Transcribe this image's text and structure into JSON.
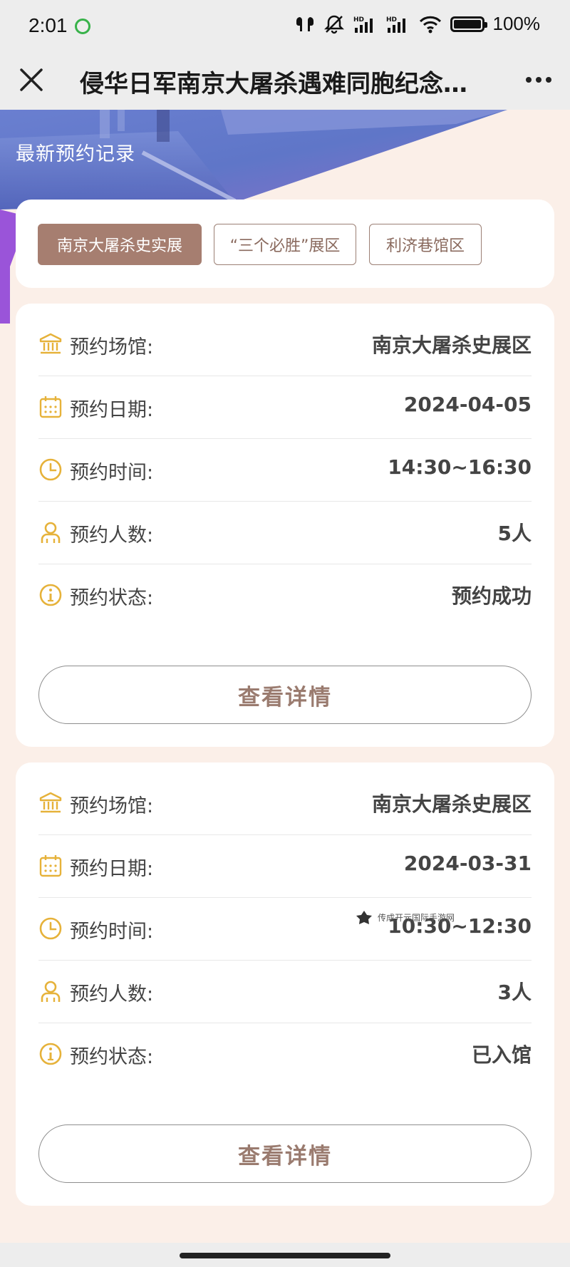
{
  "status_bar": {
    "time": "2:01",
    "battery": "100%"
  },
  "title_bar": {
    "title": "侵华日军南京大屠杀遇难同胞纪念…"
  },
  "banner": {
    "title": "最新预约记录"
  },
  "tabs": [
    {
      "label": "南京大屠杀史实展",
      "active": true
    },
    {
      "label": "“三个必胜”展区",
      "active": false
    },
    {
      "label": "利济巷馆区",
      "active": false
    }
  ],
  "records": [
    {
      "venue_label": "预约场馆:",
      "venue": "南京大屠杀史展区",
      "date_label": "预约日期:",
      "date": "2024-04-05",
      "time_label": "预约时间:",
      "time": "14:30~16:30",
      "count_label": "预约人数:",
      "count": "5人",
      "status_label": "预约状态:",
      "status": "预约成功",
      "detail_button": "查看详情"
    },
    {
      "venue_label": "预约场馆:",
      "venue": "南京大屠杀史展区",
      "date_label": "预约日期:",
      "date": "2024-03-31",
      "time_label": "预约时间:",
      "time": "10:30~12:30",
      "count_label": "预约人数:",
      "count": "3人",
      "status_label": "预约状态:",
      "status": "已入馆",
      "detail_button": "查看详情"
    }
  ],
  "watermark": "传成开元国际手游网",
  "colors": {
    "accent": "#a67e70",
    "icon": "#e6b23a",
    "background": "#fbefe8"
  }
}
